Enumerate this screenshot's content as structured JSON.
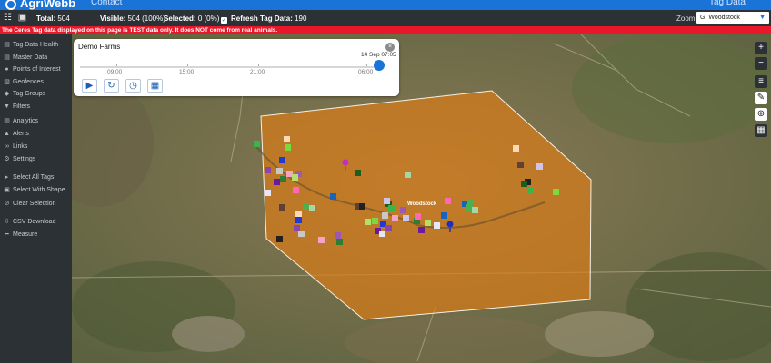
{
  "topbar": {
    "brand": "AgriWebb",
    "center_text": "Contact",
    "right_text": "Tag Data"
  },
  "status": {
    "total_label": "Total:",
    "total_value": "504",
    "visible_label": "Visible:",
    "visible_value": "504 (100%)",
    "selected_label": "Selected:",
    "selected_value": "0 (0%)",
    "refresh_label": "Refresh Tag Data:",
    "refresh_value": "190",
    "refresh_checked": true,
    "zoom_label": "Zoom",
    "zoom_value": "G: Woodstock"
  },
  "warning": "The Ceres Tag data displayed on this page is TEST data only. It does NOT come from real animals.",
  "sidebar": {
    "items": [
      {
        "icon": "tag-icon",
        "glyph": "▤",
        "label": "Tag Data Health"
      },
      {
        "icon": "database-icon",
        "glyph": "▤",
        "label": "Master Data"
      },
      {
        "icon": "map-pin-icon",
        "glyph": "●",
        "label": "Points of Interest"
      },
      {
        "icon": "geofence-icon",
        "glyph": "▧",
        "label": "Geofences"
      },
      {
        "icon": "tags-icon",
        "glyph": "◆",
        "label": "Tag Groups"
      },
      {
        "icon": "filter-icon",
        "glyph": "▼",
        "label": "Filters"
      },
      {
        "icon": "chart-icon",
        "glyph": "▥",
        "label": "Analytics"
      },
      {
        "icon": "bell-icon",
        "glyph": "▲",
        "label": "Alerts"
      },
      {
        "icon": "link-icon",
        "glyph": "∞",
        "label": "Links"
      },
      {
        "icon": "gear-icon",
        "glyph": "⚙",
        "label": "Settings"
      },
      {
        "icon": "cursor-icon",
        "glyph": "▸",
        "label": "Select All Tags"
      },
      {
        "icon": "shape-icon",
        "glyph": "▣",
        "label": "Select With Shape"
      },
      {
        "icon": "clear-icon",
        "glyph": "⊘",
        "label": "Clear Selection"
      },
      {
        "icon": "download-icon",
        "glyph": "⇩",
        "label": "CSV Download"
      },
      {
        "icon": "ruler-icon",
        "glyph": "━",
        "label": "Measure"
      }
    ]
  },
  "panel": {
    "title": "Demo Farms",
    "close": "×",
    "time_labels": [
      "09:00",
      "15:00",
      "21:00",
      "06:00"
    ],
    "current_time": "14 Sep 07:05",
    "buttons": [
      {
        "name": "play-button",
        "glyph": "▶"
      },
      {
        "name": "refresh-button",
        "glyph": "↻"
      },
      {
        "name": "history-button",
        "glyph": "◷"
      },
      {
        "name": "calendar-button",
        "glyph": "▦"
      }
    ]
  },
  "map": {
    "place_label": "Woodstock",
    "fence_color": "#e07c12"
  },
  "controls": [
    {
      "name": "zoom-in-button",
      "glyph": "+",
      "light": false
    },
    {
      "name": "zoom-out-button",
      "glyph": "−",
      "light": false
    },
    {
      "name": "layers-button",
      "glyph": "≡",
      "light": false
    },
    {
      "name": "draw-button",
      "glyph": "✎",
      "light": true
    },
    {
      "name": "locate-button",
      "glyph": "⊕",
      "light": true
    },
    {
      "name": "legend-button",
      "glyph": "▦",
      "light": false
    }
  ]
}
